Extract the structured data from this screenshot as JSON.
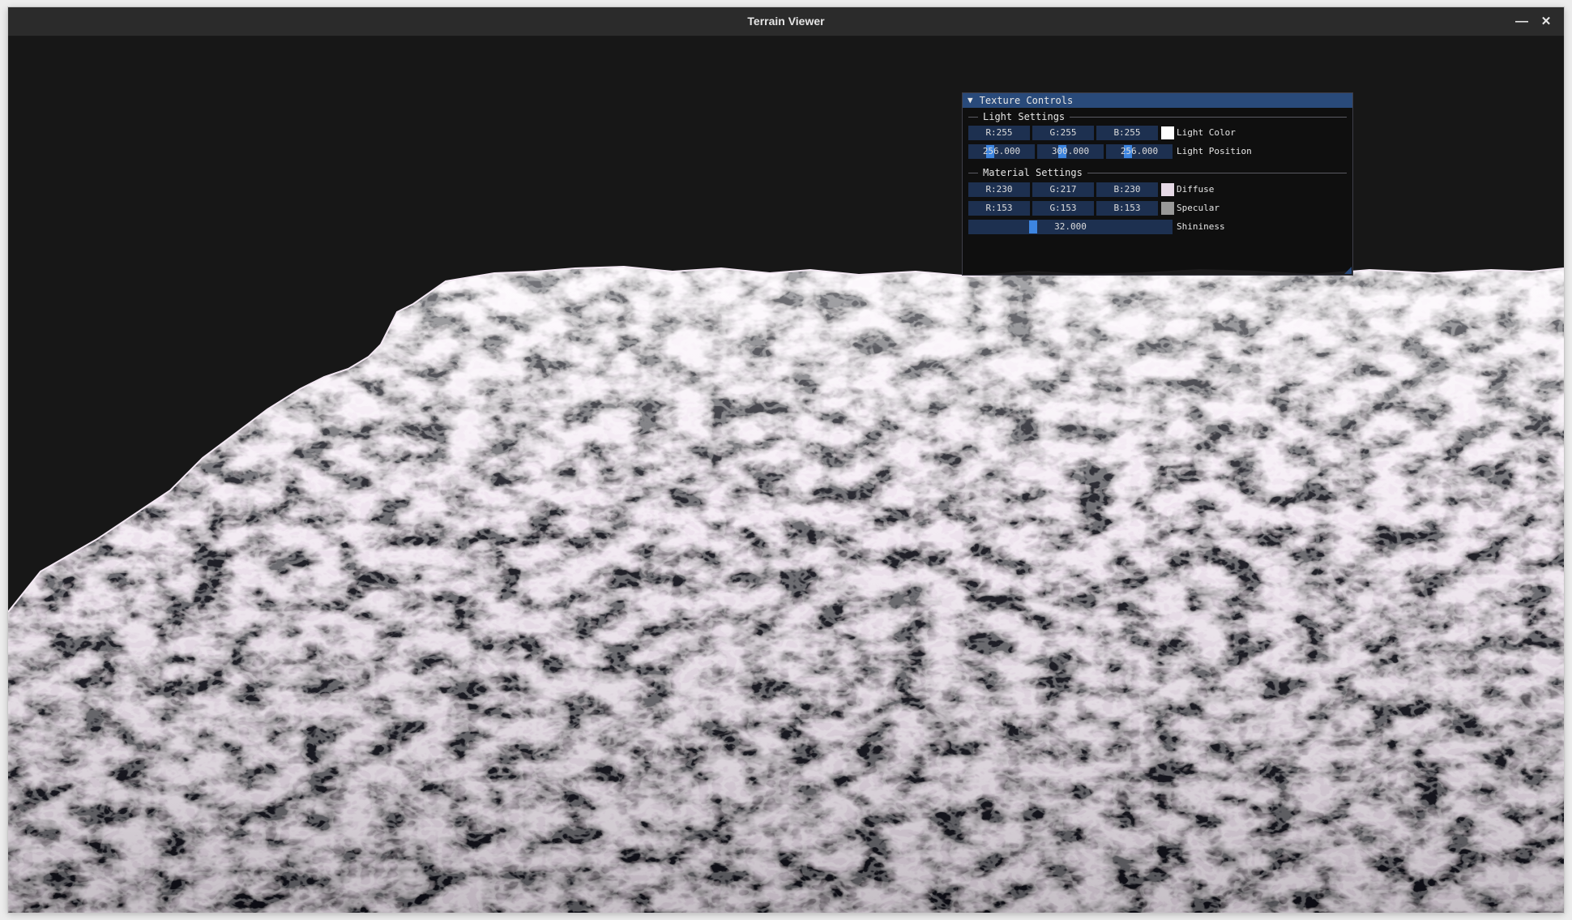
{
  "window": {
    "title": "Terrain Viewer"
  },
  "panel": {
    "title": "Texture Controls",
    "light_settings": {
      "header": "Light Settings",
      "color": {
        "r": "R:255",
        "g": "G:255",
        "b": "B:255",
        "swatch": "#ffffff",
        "label": "Light Color"
      },
      "position": {
        "x": "256.000",
        "y": "300.000",
        "z": "256.000",
        "label": "Light Position"
      }
    },
    "material_settings": {
      "header": "Material Settings",
      "diffuse": {
        "r": "R:230",
        "g": "G:217",
        "b": "B:230",
        "swatch": "#e6d9e6",
        "label": "Diffuse"
      },
      "specular": {
        "r": "R:153",
        "g": "G:153",
        "b": "B:153",
        "swatch": "#999999",
        "label": "Specular"
      },
      "shininess": {
        "value": "32.000",
        "label": "Shininess"
      }
    }
  }
}
